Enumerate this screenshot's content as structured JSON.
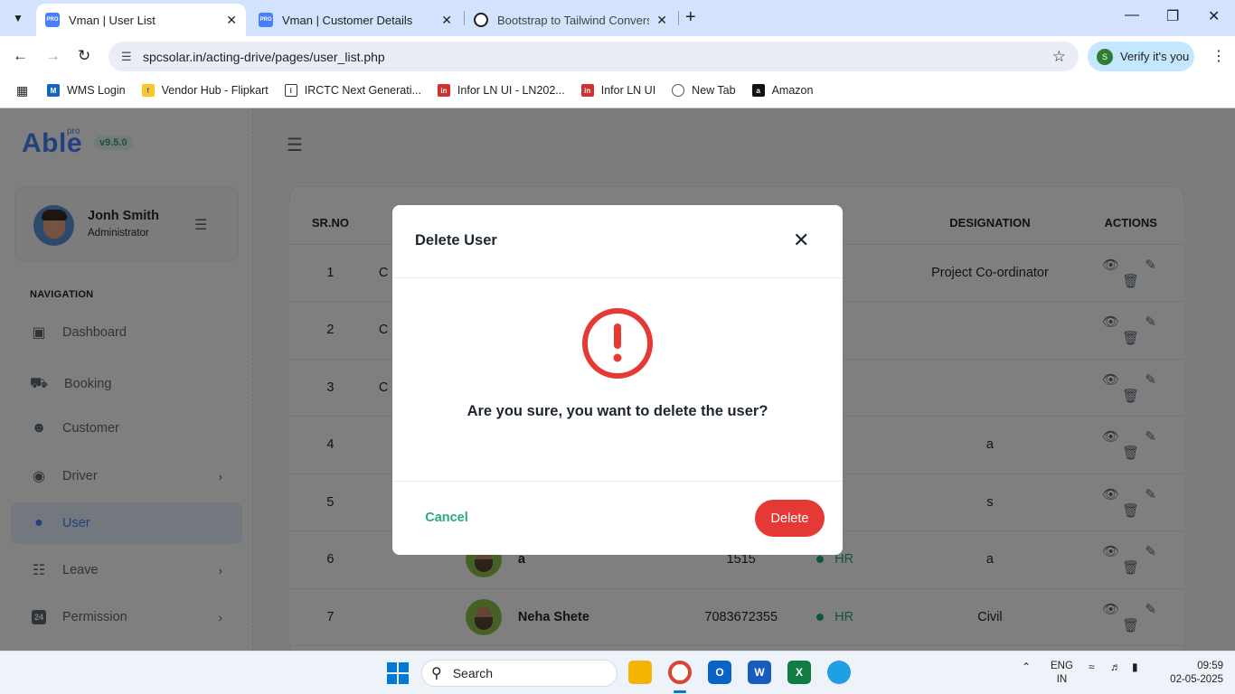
{
  "browser": {
    "tabs": [
      {
        "title": "Vman | User List",
        "favicon": "PRO",
        "active": true
      },
      {
        "title": "Vman | Customer Details",
        "favicon": "PRO",
        "active": false
      },
      {
        "title": "Bootstrap to Tailwind Conversio",
        "favicon": "chatgpt-icon",
        "active": false
      }
    ],
    "url": "spcsolar.in/acting-drive/pages/user_list.php",
    "profile_label": "Verify it's you",
    "profile_initial": "S",
    "bookmarks": [
      {
        "label": "WMS Login",
        "icon": "wms-icon"
      },
      {
        "label": "Vendor Hub - Flipkart",
        "icon": "flipkart-icon"
      },
      {
        "label": "IRCTC Next Generati...",
        "icon": "irctc-icon"
      },
      {
        "label": "Infor LN UI - LN202...",
        "icon": "infor-icon"
      },
      {
        "label": "Infor LN UI",
        "icon": "infor-icon"
      },
      {
        "label": "New Tab",
        "icon": "globe-icon"
      },
      {
        "label": "Amazon",
        "icon": "amazon-icon"
      }
    ]
  },
  "app": {
    "logo": "Able",
    "logo_badge": "pro",
    "version": "v9.5.0",
    "user": {
      "name": "Jonh Smith",
      "role": "Administrator"
    },
    "nav_caption": "NAVIGATION",
    "nav": [
      {
        "label": "Dashboard",
        "icon": "cube-icon",
        "has_children": false,
        "active": false
      },
      {
        "label": "Booking",
        "icon": "car-icon",
        "has_children": false,
        "active": false
      },
      {
        "label": "Customer",
        "icon": "people-icon",
        "has_children": false,
        "active": false
      },
      {
        "label": "Driver",
        "icon": "steering-icon",
        "has_children": true,
        "active": false
      },
      {
        "label": "User",
        "icon": "user-icon",
        "has_children": false,
        "active": true
      },
      {
        "label": "Leave",
        "icon": "calendar-x-icon",
        "has_children": true,
        "active": false
      },
      {
        "label": "Permission",
        "icon": "badge-24-icon",
        "has_children": true,
        "active": false
      }
    ]
  },
  "table": {
    "headers": [
      "SR.NO",
      "",
      "",
      "",
      "DESIGNATION",
      "ACTIONS"
    ],
    "rows": [
      {
        "sr": "1",
        "name_initial": "C",
        "name": "",
        "mobile": "",
        "dept": "",
        "designation": "Project Co-ordinator"
      },
      {
        "sr": "2",
        "name_initial": "C",
        "name": "",
        "mobile": "",
        "dept": "",
        "designation": ""
      },
      {
        "sr": "3",
        "name_initial": "C",
        "name": "",
        "mobile": "",
        "dept": "",
        "designation": ""
      },
      {
        "sr": "4",
        "name_initial": "",
        "name": "",
        "mobile": "",
        "dept": "",
        "designation": "a"
      },
      {
        "sr": "5",
        "name_initial": "",
        "name": "",
        "mobile": "",
        "dept": "",
        "designation": "s"
      },
      {
        "sr": "6",
        "name_initial": "",
        "name": "a",
        "mobile": "1515",
        "dept": "HR",
        "designation": "a"
      },
      {
        "sr": "7",
        "name_initial": "",
        "name": "Neha Shete",
        "mobile": "7083672355",
        "dept": "HR",
        "designation": "Civil"
      }
    ]
  },
  "modal": {
    "title": "Delete User",
    "message": "Are you sure, you want to delete the user?",
    "cancel_label": "Cancel",
    "delete_label": "Delete"
  },
  "taskbar": {
    "search_placeholder": "Search",
    "lang_top": "ENG",
    "lang_bottom": "IN",
    "time": "09:59",
    "date": "02-05-2025"
  },
  "colors": {
    "primary": "#4680ff",
    "success": "#2ca87f",
    "danger": "#e53935",
    "overlay": "rgba(0,0,0,0.5)"
  }
}
